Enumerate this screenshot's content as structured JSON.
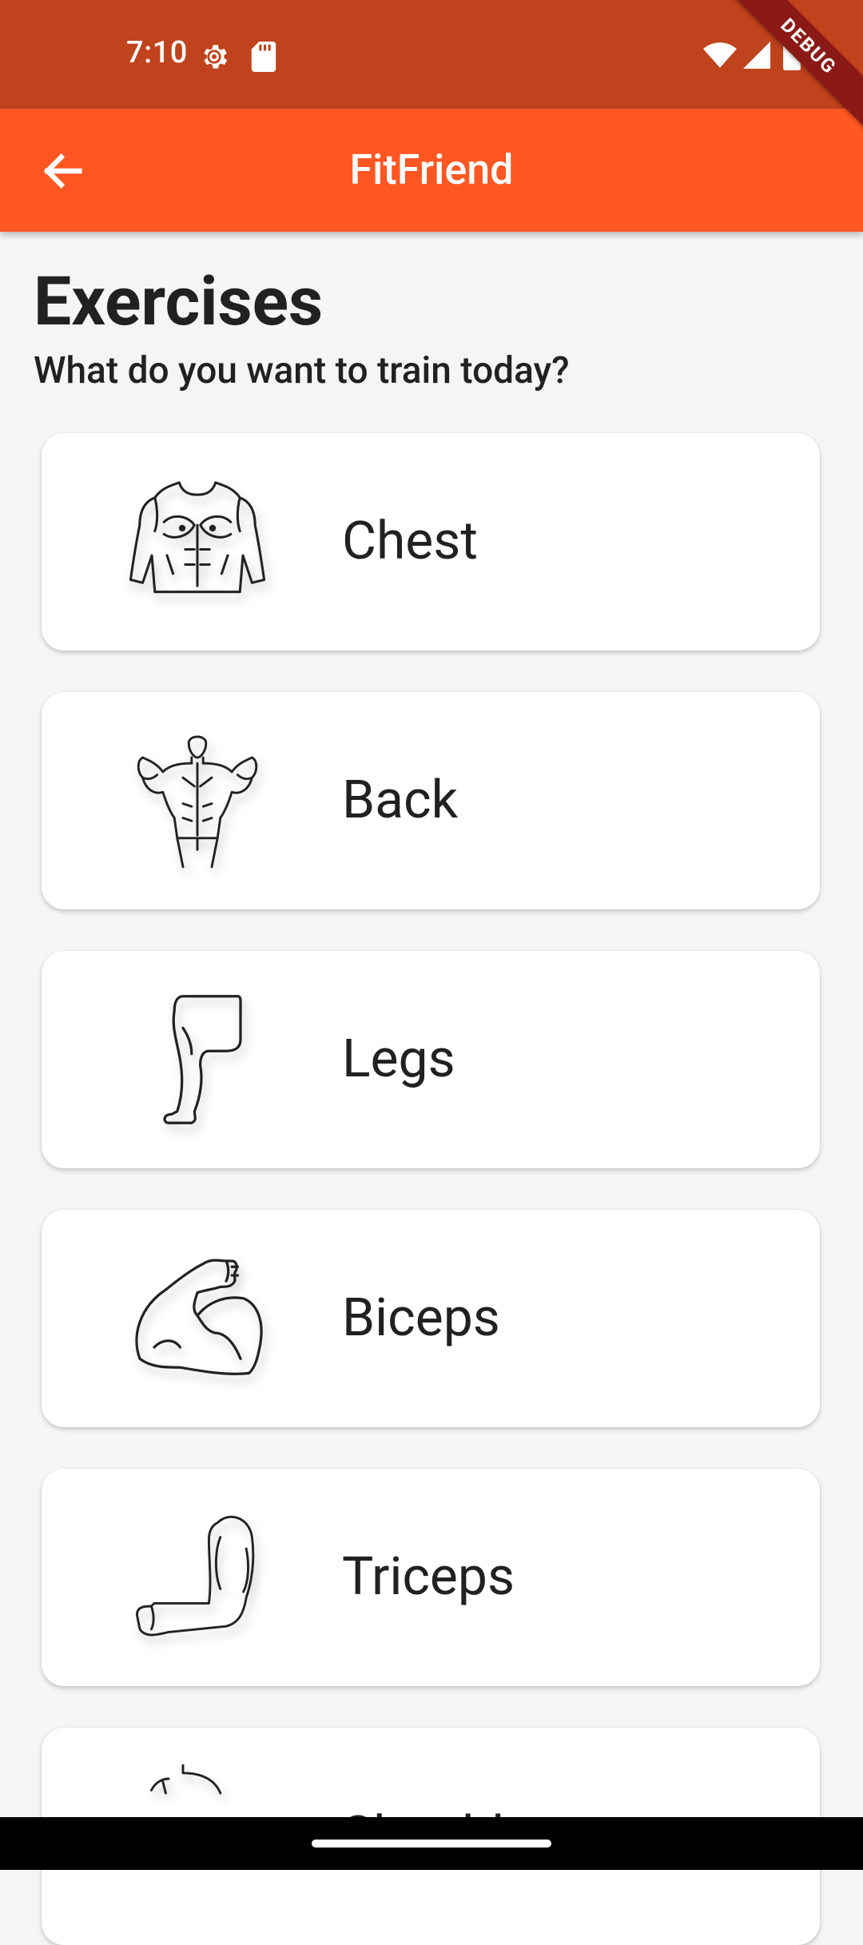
{
  "status_bar": {
    "time": "7:10",
    "debug_label": "DEBUG",
    "icons": [
      "settings-gear-icon",
      "sd-card-icon",
      "wifi-icon",
      "cell-signal-icon",
      "battery-icon"
    ]
  },
  "app_bar": {
    "title": "FitFriend",
    "back_icon": "arrow-back-icon",
    "background_color": "#FF5722",
    "status_color": "#BF431C"
  },
  "page": {
    "heading": "Exercises",
    "subheading": "What do you want to train today?"
  },
  "exercises": [
    {
      "label": "Chest",
      "icon": "chest-icon"
    },
    {
      "label": "Back",
      "icon": "back-muscle-icon"
    },
    {
      "label": "Legs",
      "icon": "leg-icon"
    },
    {
      "label": "Biceps",
      "icon": "biceps-icon"
    },
    {
      "label": "Triceps",
      "icon": "triceps-icon"
    },
    {
      "label": "Shoulders",
      "icon": "shoulders-icon"
    }
  ]
}
